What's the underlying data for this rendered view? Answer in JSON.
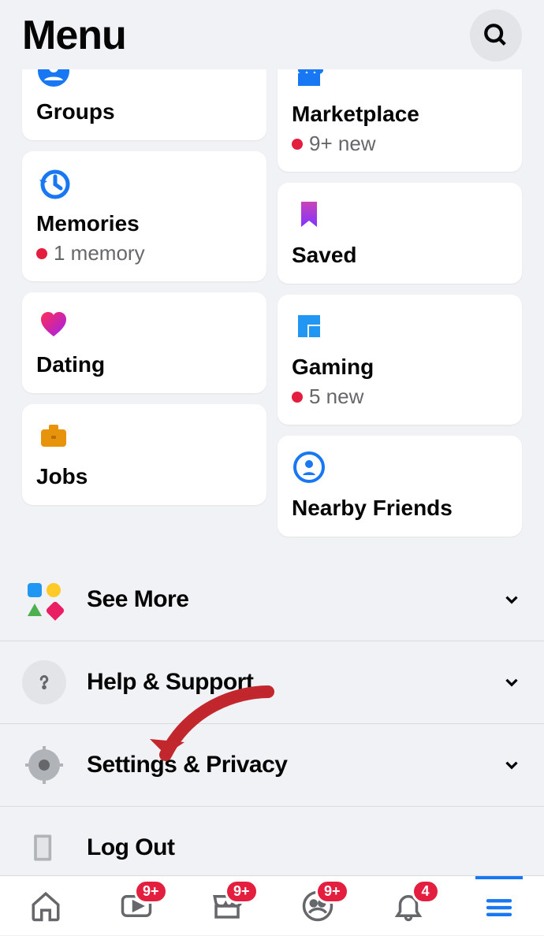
{
  "header": {
    "title": "Menu"
  },
  "cards": {
    "groups": {
      "label": "Groups"
    },
    "marketplace": {
      "label": "Marketplace",
      "sub": "9+ new"
    },
    "memories": {
      "label": "Memories",
      "sub": "1 memory"
    },
    "saved": {
      "label": "Saved"
    },
    "dating": {
      "label": "Dating"
    },
    "gaming": {
      "label": "Gaming",
      "sub": "5 new"
    },
    "jobs": {
      "label": "Jobs"
    },
    "nearby": {
      "label": "Nearby Friends"
    }
  },
  "list": {
    "see_more": "See More",
    "help": "Help & Support",
    "settings": "Settings & Privacy",
    "logout": "Log Out"
  },
  "tabbar": {
    "home_badge": "",
    "watch_badge": "9+",
    "market_badge": "9+",
    "groups_badge": "9+",
    "notif_badge": "4"
  }
}
